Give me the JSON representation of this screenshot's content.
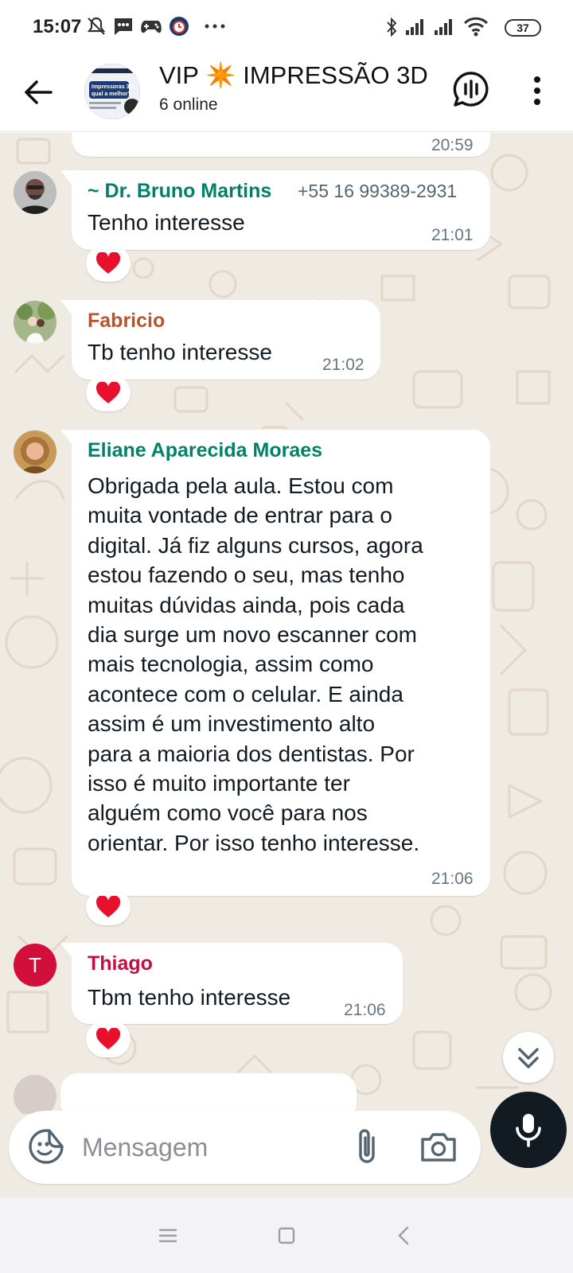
{
  "status_bar": {
    "time": "15:07",
    "left_icons": [
      "mute-icon",
      "sms-icon",
      "gamepad-icon",
      "alarm-app-icon",
      "more-dots-icon"
    ],
    "right_icons": [
      "bluetooth-icon",
      "signal-icon",
      "signal-icon",
      "wifi-icon"
    ],
    "battery": "37"
  },
  "header": {
    "title": "VIP ✴️ IMPRESSÃO 3D",
    "subtitle": "6 online",
    "avatar_text": "Impressoras 3D, qual a melhor?",
    "avatar_small": "Webinar"
  },
  "colors": {
    "chat_bg": "#efeae2",
    "doodle": "#e2d7c8",
    "name_bruno": "#008069",
    "name_fabricio": "#b5552e",
    "name_eliane": "#008069",
    "name_thiago": "#c0113f",
    "heart": "#e8112d",
    "mic_bg": "#121b22"
  },
  "messages": [
    {
      "time": "20:59"
    },
    {
      "sender": "~ Dr. Bruno Martins",
      "phone": "+55 16 99389-2931",
      "text": "Tenho interesse",
      "time": "21:01",
      "reaction": "❤️"
    },
    {
      "sender": "Fabricio",
      "text": "Tb tenho interesse",
      "time": "21:02",
      "reaction": "❤️"
    },
    {
      "sender": "Eliane Aparecida Moraes",
      "lines": [
        "Obrigada pela aula. Estou com",
        "muita vontade de entrar para o",
        "digital. Já fiz alguns cursos, agora",
        "estou fazendo o seu, mas tenho",
        "muitas dúvidas ainda, pois cada",
        "dia surge um novo  escanner com",
        "mais tecnologia, assim  como",
        "acontece com o celular. E ainda",
        "assim é um investimento alto",
        "para a maioria dos dentistas. Por",
        "isso é muito importante ter",
        "alguém como você para nos",
        "orientar. Por isso tenho interesse."
      ],
      "time": "21:06",
      "reaction": "❤️"
    },
    {
      "sender": "Thiago",
      "avatar_letter": "T",
      "text": "Tbm tenho interesse",
      "time": "21:06",
      "reaction": "❤️"
    }
  ],
  "composer": {
    "placeholder": "Mensagem"
  }
}
